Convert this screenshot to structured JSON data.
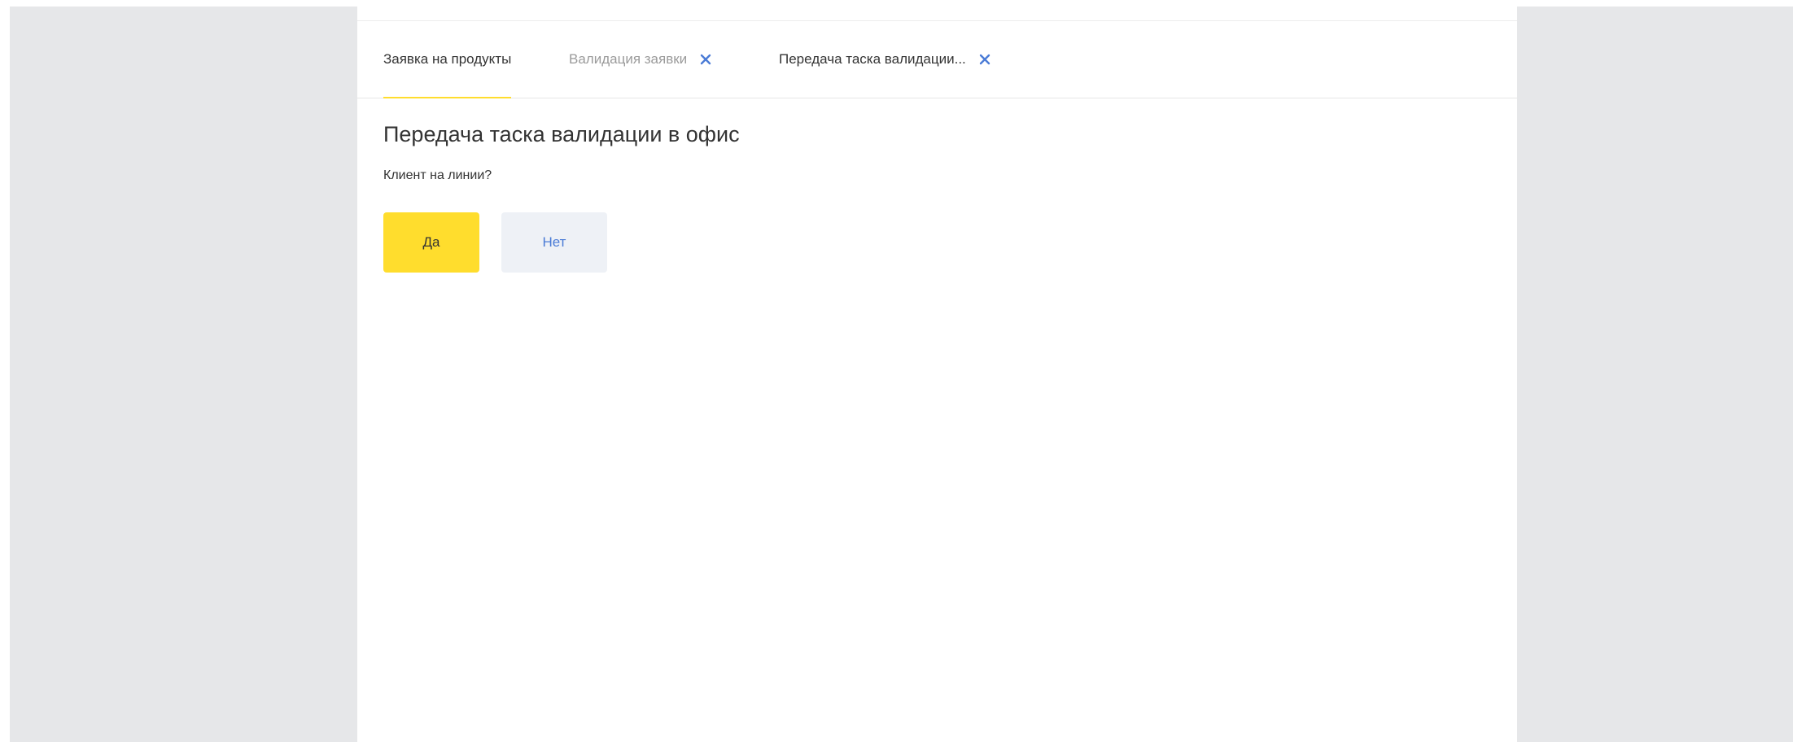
{
  "tabs": [
    {
      "label": "Заявка на продукты",
      "active": true,
      "closable": false
    },
    {
      "label": "Валидация заявки",
      "active": false,
      "closable": true
    },
    {
      "label": "Передача таска валидации...",
      "active": false,
      "closable": true
    }
  ],
  "page": {
    "title": "Передача таска валидации в офис",
    "question": "Клиент на линии?"
  },
  "actions": {
    "yes_label": "Да",
    "no_label": "Нет"
  },
  "colors": {
    "accent": "#ffdd2d",
    "close_icon": "#4a7bd6",
    "no_button_bg": "#eef1f6",
    "no_button_text": "#4a7bd6",
    "side_background": "#e6e7e9"
  },
  "icons": {
    "tab_close": "close-icon"
  }
}
